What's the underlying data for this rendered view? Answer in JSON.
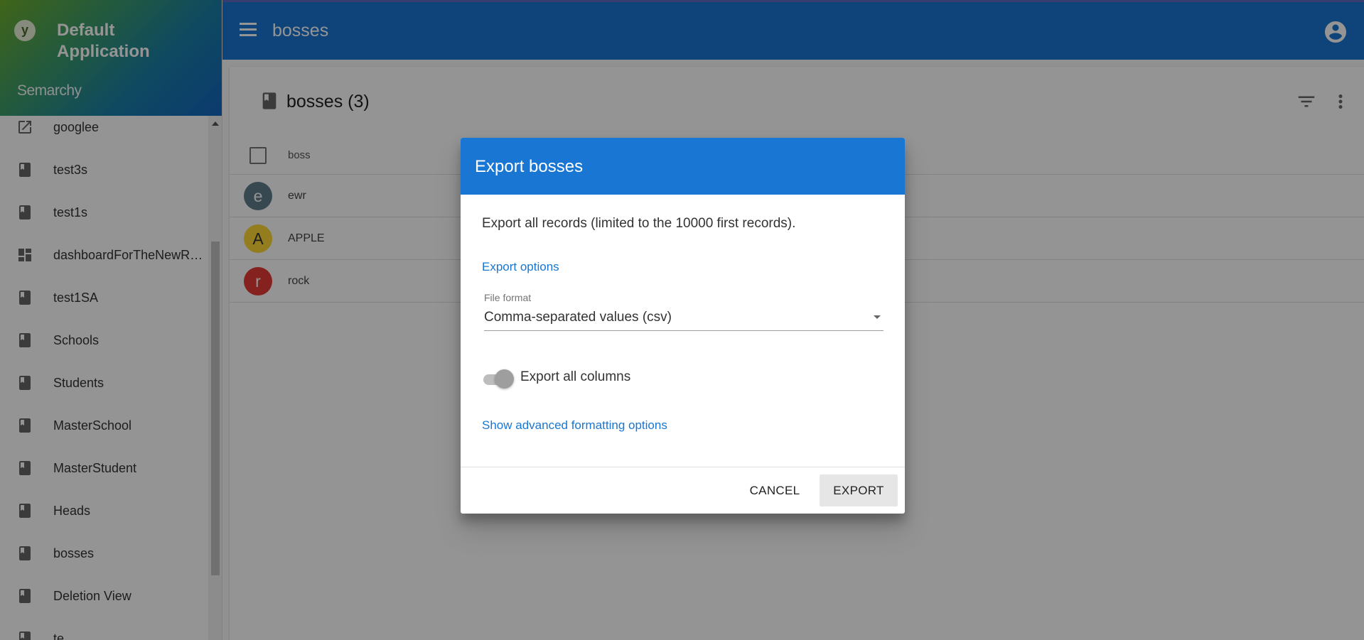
{
  "app": {
    "logo_letter": "y",
    "name": "Default Application",
    "brand": "Semarchy"
  },
  "topbar": {
    "title": "bosses",
    "menu_icon": "menu-icon",
    "account_icon": "account-circle-icon"
  },
  "sidebar": {
    "items": [
      {
        "label": "googlee",
        "icon": "open-external-icon"
      },
      {
        "label": "test3s",
        "icon": "book-icon"
      },
      {
        "label": "test1s",
        "icon": "book-icon"
      },
      {
        "label": "dashboardForTheNewRev...",
        "icon": "dashboard-icon"
      },
      {
        "label": "test1SA",
        "icon": "book-icon"
      },
      {
        "label": "Schools",
        "icon": "book-icon"
      },
      {
        "label": "Students",
        "icon": "book-icon"
      },
      {
        "label": "MasterSchool",
        "icon": "book-icon"
      },
      {
        "label": "MasterStudent",
        "icon": "book-icon"
      },
      {
        "label": "Heads",
        "icon": "book-icon"
      },
      {
        "label": "bosses",
        "icon": "book-icon"
      },
      {
        "label": "Deletion View",
        "icon": "book-icon"
      },
      {
        "label": "te",
        "icon": "book-icon"
      }
    ]
  },
  "main": {
    "title": "bosses (3)",
    "column_header": "boss",
    "rows": [
      {
        "initial": "e",
        "label": "ewr",
        "color": "#607d8b"
      },
      {
        "initial": "A",
        "label": "APPLE",
        "color": "#fdd835"
      },
      {
        "initial": "r",
        "label": "rock",
        "color": "#e53935"
      }
    ]
  },
  "dialog": {
    "title": "Export bosses",
    "description": "Export all records (limited to the 10000 first records).",
    "export_options_link": "Export options",
    "file_format_label": "File format",
    "file_format_value": "Comma-separated values (csv)",
    "toggle_label": "Export all columns",
    "advanced_link": "Show advanced formatting options",
    "cancel_label": "CANCEL",
    "export_label": "EXPORT"
  },
  "colors": {
    "primary": "#1976d2"
  }
}
